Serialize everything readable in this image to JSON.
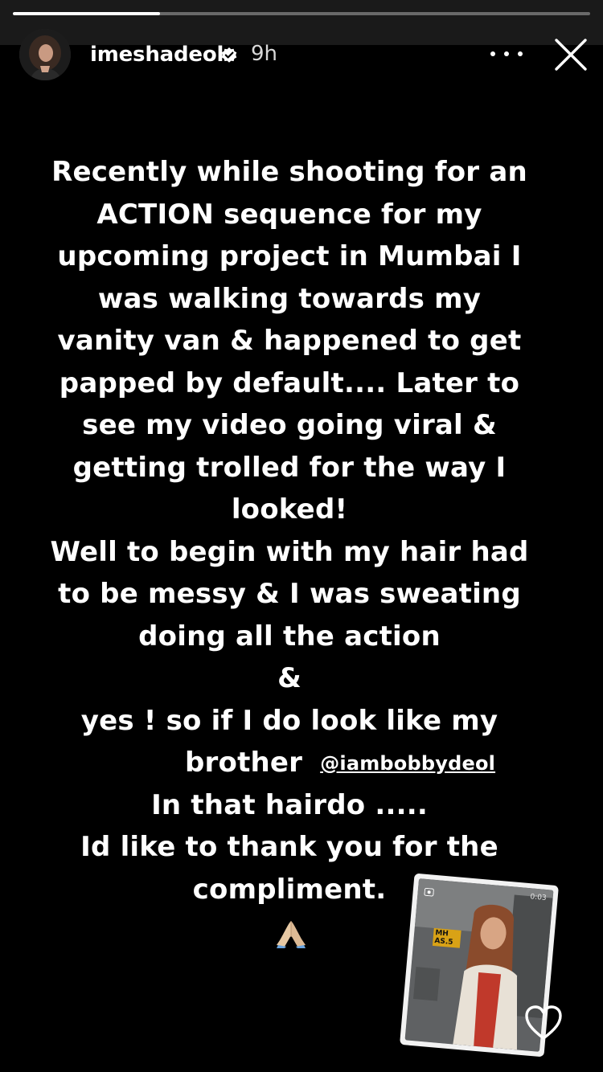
{
  "story": {
    "progress": 0.255,
    "username": "imeshadeol",
    "time": "9h",
    "icons": {
      "verified": "verified-badge-icon",
      "more": "more-options-icon",
      "close": "close-icon",
      "reaction": "like-heart-icon",
      "emoji": "folded-hands-emoji"
    },
    "text_lines": [
      "Recently while shooting for an",
      "ACTION  sequence for my",
      "upcoming project in Mumbai I",
      "was walking towards my",
      "vanity van & happened to get",
      "papped by default.... Later to",
      "see my video going viral &",
      "getting trolled for the way I",
      "looked!",
      "Well to begin with my hair had",
      "to be messy & I was sweating",
      "doing all the action",
      "&",
      "yes ! so if I do look like my"
    ],
    "brother_line": {
      "text": "brother",
      "mention": "@iambobbydeol"
    },
    "text_lines_after": [
      "In that hairdo .....",
      "Id like to thank you for the",
      "compliment."
    ],
    "sticker": {
      "time_label": "0:03",
      "sign_text": "MH AS.5"
    }
  }
}
